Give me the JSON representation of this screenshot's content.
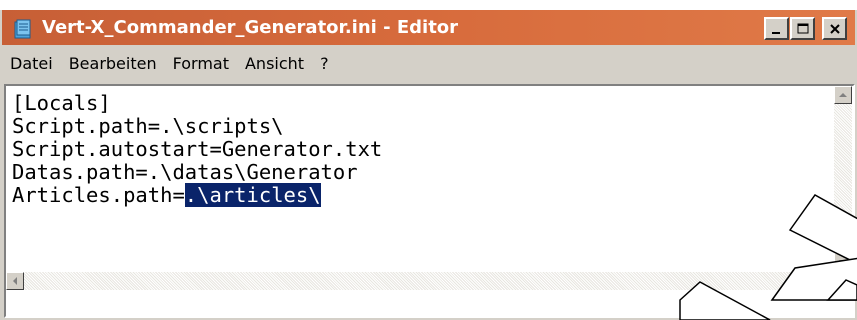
{
  "window": {
    "title": "Vert-X_Commander_Generator.ini - Editor",
    "titlebar_color": "#d0663a"
  },
  "menu": {
    "items": [
      "Datei",
      "Bearbeiten",
      "Format",
      "Ansicht",
      "?"
    ]
  },
  "editor": {
    "lines": [
      "[Locals]",
      "Script.path=.\\scripts\\",
      "Script.autostart=Generator.txt",
      "Datas.path=.\\datas\\Generator"
    ],
    "last_line_prefix": "Articles.path=",
    "last_line_selected": ".\\articles\\",
    "selection_color": "#0a246a"
  },
  "icons": {
    "app": "notepad-icon",
    "minimize": "minimize-icon",
    "maximize": "maximize-icon",
    "close": "close-icon"
  }
}
